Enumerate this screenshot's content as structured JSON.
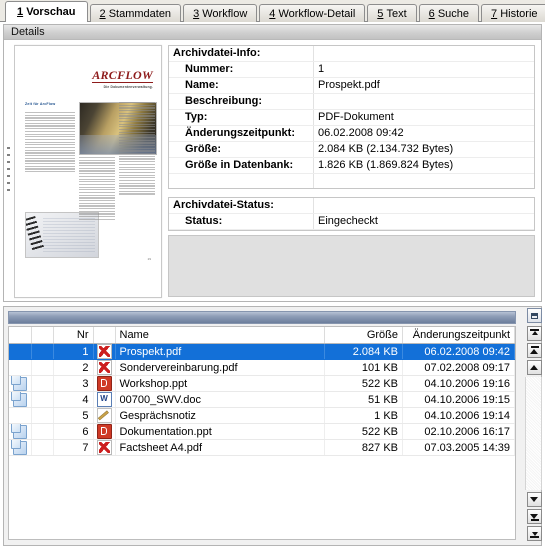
{
  "tabs": [
    {
      "accel": "1",
      "label": "Vorschau",
      "active": true
    },
    {
      "accel": "2",
      "label": "Stammdaten",
      "active": false
    },
    {
      "accel": "3",
      "label": "Workflow",
      "active": false
    },
    {
      "accel": "4",
      "label": "Workflow-Detail",
      "active": false
    },
    {
      "accel": "5",
      "label": "Text",
      "active": false
    },
    {
      "accel": "6",
      "label": "Suche",
      "active": false
    },
    {
      "accel": "7",
      "label": "Historie",
      "active": false
    }
  ],
  "details": {
    "header_title": "Details",
    "preview": {
      "logo_text": "ARCFLOW",
      "logo_tagline": "Die Dokumentenverwaltung.",
      "doc_heading": "Zeit für ArcFlow",
      "page_number": "29"
    },
    "info": {
      "section_info_title": "Archivdatei-Info:",
      "rows": [
        {
          "label": "Nummer:",
          "value": "1"
        },
        {
          "label": "Name:",
          "value": "Prospekt.pdf"
        },
        {
          "label": "Beschreibung:",
          "value": ""
        },
        {
          "label": "Typ:",
          "value": "PDF-Dokument"
        },
        {
          "label": "Änderungszeitpunkt:",
          "value": "06.02.2008  09:42"
        },
        {
          "label": "Größe:",
          "value": "2.084 KB  (2.134.732 Bytes)"
        },
        {
          "label": "Größe in Datenbank:",
          "value": "1.826 KB  (1.869.824 Bytes)"
        }
      ],
      "section_status_title": "Archivdatei-Status:",
      "status_rows": [
        {
          "label": "Status:",
          "value": "Eingecheckt"
        }
      ]
    }
  },
  "filelist": {
    "restore_button_label": "restore-icon",
    "columns": {
      "flag": "",
      "nr": "Nr",
      "icon": "",
      "name": "Name",
      "size": "Größe",
      "date": "Änderungszeitpunkt"
    },
    "rows": [
      {
        "copy": false,
        "nr": "1",
        "icon": "pdf",
        "name": "Prospekt.pdf",
        "size": "2.084 KB",
        "date": "06.02.2008  09:42",
        "selected": true
      },
      {
        "copy": false,
        "nr": "2",
        "icon": "pdf",
        "name": "Sondervereinbarung.pdf",
        "size": "101 KB",
        "date": "07.02.2008  09:17",
        "selected": false
      },
      {
        "copy": true,
        "nr": "3",
        "icon": "ppt",
        "name": "Workshop.ppt",
        "size": "522 KB",
        "date": "04.10.2006  19:16",
        "selected": false
      },
      {
        "copy": true,
        "nr": "4",
        "icon": "doc",
        "name": "00700_SWV.doc",
        "size": "51 KB",
        "date": "04.10.2006  19:15",
        "selected": false
      },
      {
        "copy": false,
        "nr": "5",
        "icon": "note",
        "name": "Gesprächsnotiz",
        "size": "1 KB",
        "date": "04.10.2006  19:14",
        "selected": false
      },
      {
        "copy": true,
        "nr": "6",
        "icon": "ppt",
        "name": "Dokumentation.ppt",
        "size": "522 KB",
        "date": "02.10.2006  16:17",
        "selected": false
      },
      {
        "copy": true,
        "nr": "7",
        "icon": "pdf",
        "name": "Factsheet A4.pdf",
        "size": "827 KB",
        "date": "07.03.2005  14:39",
        "selected": false
      }
    ]
  },
  "navigator": {
    "corner": "restore-icon",
    "buttons_top": [
      "first-record-icon",
      "previous-page-icon",
      "previous-record-icon"
    ],
    "buttons_bottom": [
      "next-record-icon",
      "next-page-icon",
      "last-record-icon"
    ]
  },
  "colors": {
    "selection": "#1370d8",
    "accent_logo": "#8e1b1b",
    "titlebar": "#6c7e9c"
  }
}
